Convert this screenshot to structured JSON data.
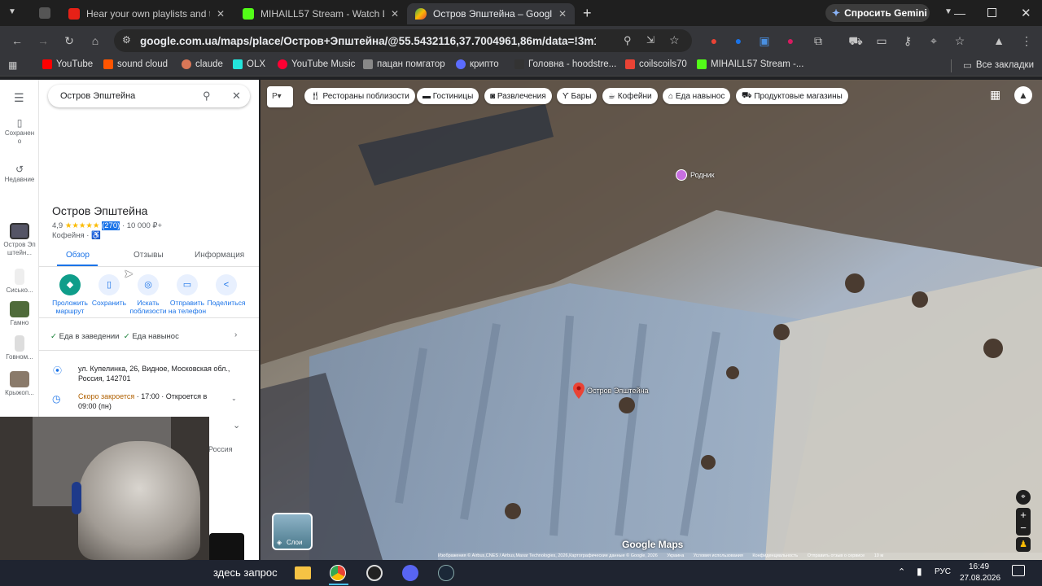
{
  "browser": {
    "tabs": [
      {
        "title": "Hear your own playlists and the",
        "favicon": "youtube-red",
        "color": "#e62117"
      },
      {
        "title": "MIHAILL57 Stream - Watch Live",
        "favicon": "kick-green",
        "color": "#53fc18"
      },
      {
        "title": "Остров Эпштейна – Google Ка",
        "favicon": "maps-pin",
        "color": "#34a853",
        "active": true
      }
    ],
    "gemini_label": "Спросить Gemini",
    "url": "google.com.ua/maps/place/Остров+Эпштейна/@55.5432116,37.7004961,86m/data=!3m1!1e3!4m6!3m...",
    "bookmarks": [
      {
        "label": "YouTube",
        "color": "#ff0000"
      },
      {
        "label": "sound cloud",
        "color": "#ff5500"
      },
      {
        "label": "claude",
        "color": "#d97757"
      },
      {
        "label": "OLX",
        "color": "#23e5db"
      },
      {
        "label": "YouTube Music",
        "color": "#ff0033"
      },
      {
        "label": "пацан помгатор",
        "color": "#888888"
      },
      {
        "label": "крипто",
        "color": "#5b6cff"
      },
      {
        "label": "Головна - hoodstre...",
        "color": "#333333"
      },
      {
        "label": "coilscoils70",
        "color": "#ea4335"
      },
      {
        "label": "MIHAILL57 Stream -...",
        "color": "#53fc18"
      }
    ],
    "all_bookmarks": "Все закладки"
  },
  "rail": {
    "saved": "Сохранено",
    "recent": "Недавние",
    "items": [
      "Остров Эпштейн...",
      "Сисько...",
      "Гамно",
      "Говном...",
      "Крыжоп..."
    ]
  },
  "place": {
    "search_value": "Остров Эпштейна",
    "name": "Остров Эпштейна",
    "rating": "4,9",
    "stars": "★★★★★",
    "reviews": "(270)",
    "price": "· 10 000 ₽+",
    "category": "Кофейня · ♿",
    "tabs": [
      "Обзор",
      "Отзывы",
      "Информация"
    ],
    "actions": [
      {
        "label": "Проложить маршрут",
        "icon": "◆"
      },
      {
        "label": "Сохранить",
        "icon": "▯"
      },
      {
        "label": "Искать поблизости",
        "icon": "◎"
      },
      {
        "label": "Отправить на телефон",
        "icon": "▭"
      },
      {
        "label": "Поделиться",
        "icon": "<"
      }
    ],
    "service_1": "Еда в заведении",
    "service_2": "Еда навынос",
    "address": "ул. Купелинка, 26, Видное, Московская обл., Россия, 142701",
    "hours_status": "Скоро закроется",
    "hours_rest": " · 17:00 · Откроется в 09:00 (пн)",
    "hidden_country": "Россия"
  },
  "map": {
    "chips": [
      "Рестораны поблизости",
      "Гостиницы",
      "Развлечения",
      "Бары",
      "Кофейни",
      "Еда навынос",
      "Продуктовые магазины"
    ],
    "pin_label": "Остров Эпштейна",
    "poi_label": "Родник",
    "layers_label": "Слои",
    "brand": "Google Maps",
    "attribution": "Изображения © Airbus,CNES / Airbus,Maxar Technologies, 2026,Картографические данные © Google, 2026",
    "footer_links": [
      "Украина",
      "Условия использования",
      "Конфиденциальность",
      "Отправить отзыв о сервисе",
      "10 м"
    ]
  },
  "taskbar": {
    "search_text": "здесь запрос",
    "lang": "РУС",
    "time": "16:49",
    "date": "27.08.2026"
  }
}
